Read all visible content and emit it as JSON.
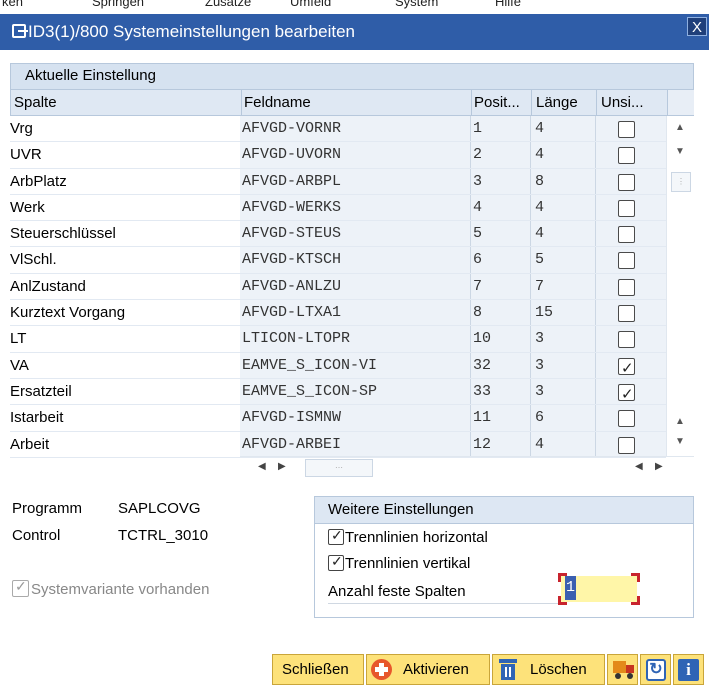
{
  "menu_strip": [
    "ken",
    "Springen",
    "Zusätze",
    "Umfeld",
    "System",
    "Hilfe"
  ],
  "window": {
    "title": "ID3(1)/800 Systemeinstellungen bearbeiten",
    "close_glyph": "X"
  },
  "table": {
    "caption": "Aktuelle Einstellung",
    "headers": [
      "Spalte",
      "Feldname",
      "Posit...",
      "Länge",
      "Unsi..."
    ],
    "rows": [
      {
        "spalte": "Vrg",
        "feldname": "AFVGD-VORNR",
        "position": "1",
        "laenge": "4",
        "unsichtbar": false
      },
      {
        "spalte": "UVR",
        "feldname": "AFVGD-UVORN",
        "position": "2",
        "laenge": "4",
        "unsichtbar": false
      },
      {
        "spalte": "ArbPlatz",
        "feldname": "AFVGD-ARBPL",
        "position": "3",
        "laenge": "8",
        "unsichtbar": false
      },
      {
        "spalte": "Werk",
        "feldname": "AFVGD-WERKS",
        "position": "4",
        "laenge": "4",
        "unsichtbar": false
      },
      {
        "spalte": "Steuerschlüssel",
        "feldname": "AFVGD-STEUS",
        "position": "5",
        "laenge": "4",
        "unsichtbar": false
      },
      {
        "spalte": "VlSchl.",
        "feldname": "AFVGD-KTSCH",
        "position": "6",
        "laenge": "5",
        "unsichtbar": false
      },
      {
        "spalte": "AnlZustand",
        "feldname": "AFVGD-ANLZU",
        "position": "7",
        "laenge": "7",
        "unsichtbar": false
      },
      {
        "spalte": "Kurztext Vorgang",
        "feldname": "AFVGD-LTXA1",
        "position": "8",
        "laenge": "15",
        "unsichtbar": false
      },
      {
        "spalte": "LT",
        "feldname": "LTICON-LTOPR",
        "position": "10",
        "laenge": "3",
        "unsichtbar": false
      },
      {
        "spalte": "VA",
        "feldname": "EAMVE_S_ICON-VI",
        "position": "32",
        "laenge": "3",
        "unsichtbar": true
      },
      {
        "spalte": "Ersatzteil",
        "feldname": "EAMVE_S_ICON-SP",
        "position": "33",
        "laenge": "3",
        "unsichtbar": true
      },
      {
        "spalte": "Istarbeit",
        "feldname": "AFVGD-ISMNW",
        "position": "11",
        "laenge": "6",
        "unsichtbar": false
      },
      {
        "spalte": "Arbeit",
        "feldname": "AFVGD-ARBEI",
        "position": "12",
        "laenge": "4",
        "unsichtbar": false
      }
    ]
  },
  "info": {
    "programm_label": "Programm",
    "programm_value": "SAPLCOVG",
    "control_label": "Control",
    "control_value": "TCTRL_3010",
    "systemvariante": "Systemvariante vorhanden"
  },
  "weitere": {
    "title": "Weitere Einstellungen",
    "opt_horizontal": "Trennlinien horizontal",
    "opt_vertikal": "Trennlinien vertikal",
    "anzahl_label": "Anzahl feste Spalten",
    "anzahl_value": "1"
  },
  "buttons": {
    "schliessen": "Schließen",
    "aktivieren": "Aktivieren",
    "loeschen": "Löschen"
  },
  "colors": {
    "titlebar": "#2f5da8",
    "button": "#fde27a",
    "input_highlight": "#fff6a8",
    "required_marker": "#c8232d"
  }
}
